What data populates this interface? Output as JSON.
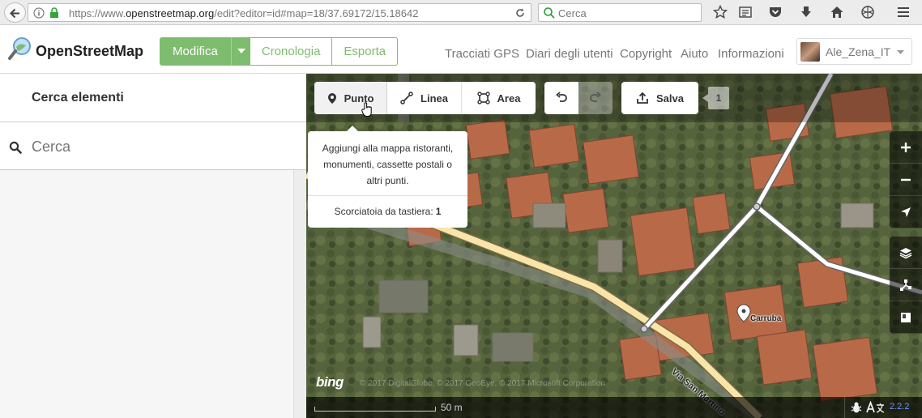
{
  "browser": {
    "url_prefix": "https://www.",
    "url_host": "openstreetmap.org",
    "url_rest": "/edit?editor=id#map=18/37.69172/15.18642",
    "search_placeholder": "Cerca"
  },
  "header": {
    "brand": "OpenStreetMap",
    "tabs": {
      "edit": "Modifica",
      "history": "Cronologia",
      "export": "Esporta"
    },
    "nav": [
      "Tracciati GPS",
      "Diari degli utenti",
      "Copyright",
      "Aiuto",
      "Informazioni"
    ],
    "user": "Ale_Zena_IT"
  },
  "sidebar": {
    "title": "Cerca elementi",
    "search_placeholder": "Cerca"
  },
  "toolbar": {
    "point": "Punto",
    "line": "Linea",
    "area": "Area",
    "save": "Salva",
    "save_count": "1"
  },
  "tooltip": {
    "body": "Aggiungi alla mappa ristoranti, monumenti, cassette postali o altri punti.",
    "shortcut_label": "Scorciatoia da tastiera:",
    "shortcut_key": "1"
  },
  "map": {
    "poi": "Carruba",
    "street": "Via San Martino",
    "bing": "bing",
    "attribution": "© 2017 DigitalGlobe, © 2017 GeoEye, © 2017 Microsoft Corporation",
    "scale": "50 m",
    "version": "2.2.2"
  },
  "colors": {
    "osm_green": "#7ebc6f",
    "primary_road": "#f9e5a8",
    "version_link": "#7092ff"
  }
}
